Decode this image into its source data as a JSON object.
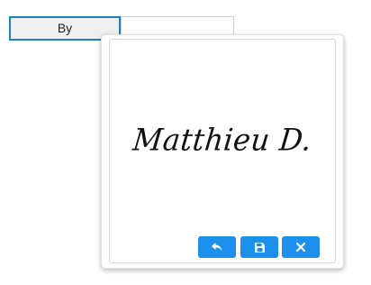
{
  "form": {
    "by_label": "By"
  },
  "signature_popup": {
    "signature_text": "Matthieu D.",
    "buttons": [
      {
        "name": "undo",
        "icon": "undo-arrow-icon"
      },
      {
        "name": "save",
        "icon": "floppy-disk-icon"
      },
      {
        "name": "close",
        "icon": "close-x-icon"
      }
    ],
    "colors": {
      "button_bg": "#1d8fec",
      "label_border": "#1b82c2"
    }
  }
}
